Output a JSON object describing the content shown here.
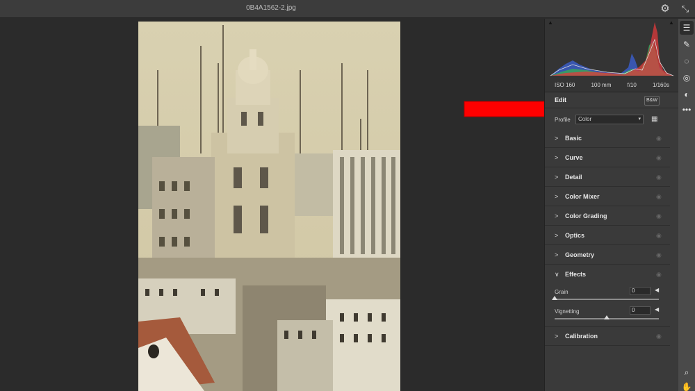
{
  "window": {
    "title": "0B4A1562-2.jpg"
  },
  "titlebar": {
    "settings_icon": "gear-icon",
    "collapse_icon": "collapse-icon"
  },
  "histogram": {
    "clip_left_icon": "shadow-clipping-icon",
    "clip_right_icon": "highlight-clipping-icon",
    "colors": {
      "red": "#e0393b",
      "green": "#39b54a",
      "blue": "#3b62d8"
    }
  },
  "exif": {
    "iso": "ISO 160",
    "focal": "100 mm",
    "aperture": "f/10",
    "shutter": "1/160s"
  },
  "edit": {
    "title": "Edit",
    "bw_label": "B&W",
    "profile_label": "Profile",
    "profile_value": "Color",
    "profile_browser_icon": "profile-browser-icon"
  },
  "sections": [
    {
      "name": "Basic",
      "expanded": false
    },
    {
      "name": "Curve",
      "expanded": false
    },
    {
      "name": "Detail",
      "expanded": false
    },
    {
      "name": "Color Mixer",
      "expanded": false
    },
    {
      "name": "Color Grading",
      "expanded": false
    },
    {
      "name": "Optics",
      "expanded": false
    },
    {
      "name": "Geometry",
      "expanded": false
    },
    {
      "name": "Effects",
      "expanded": true
    },
    {
      "name": "Calibration",
      "expanded": false
    }
  ],
  "effects": {
    "grain": {
      "label": "Grain",
      "value": "0",
      "slider_level": 0
    },
    "vignetting": {
      "label": "Vignetting",
      "value": "0",
      "slider_level": 0.5
    }
  },
  "toolbar": {
    "tools": [
      "edit-sliders-icon",
      "healing-icon",
      "masking-icon",
      "red-eye-icon",
      "presets-icon",
      "more-options-icon"
    ],
    "bottom_tools": [
      "zoom-icon",
      "hand-icon"
    ]
  },
  "annotation": {
    "arrow_color": "#ff0000"
  }
}
